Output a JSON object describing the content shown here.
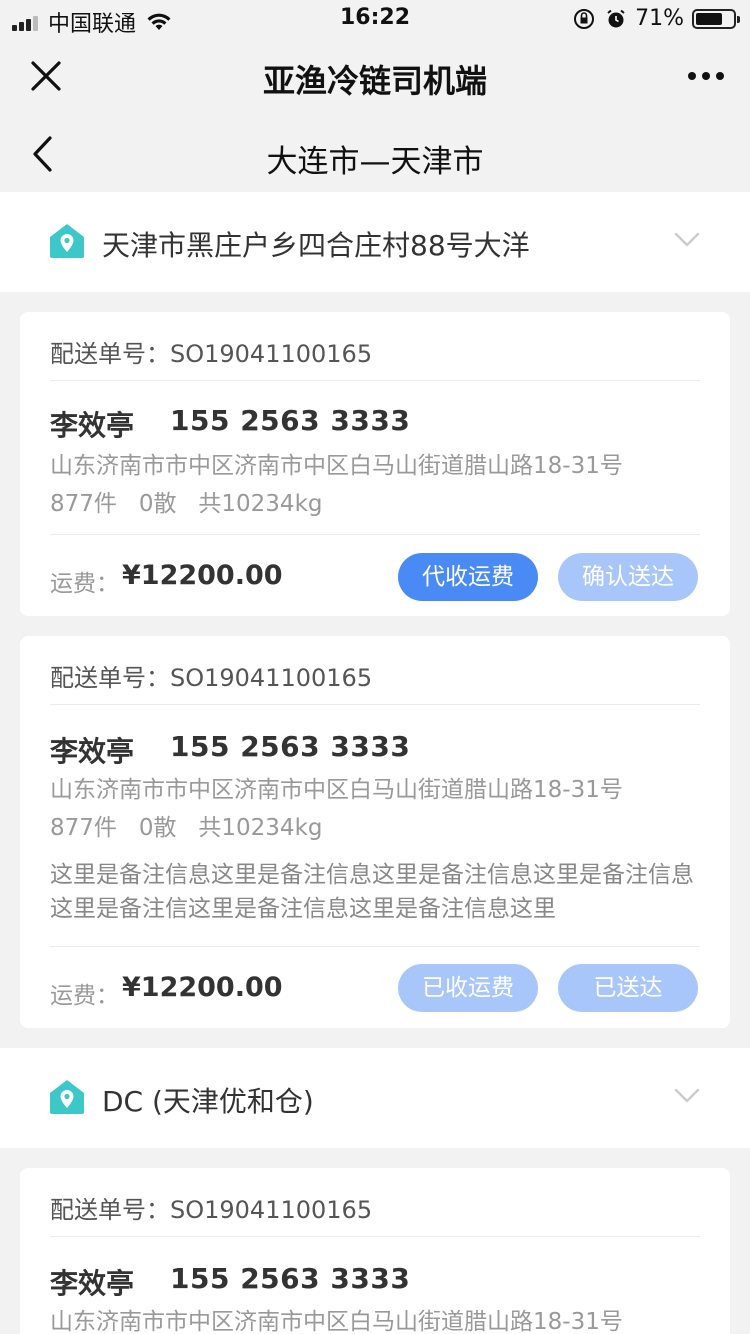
{
  "status_bar": {
    "carrier": "中国联通",
    "time": "16:22",
    "battery": "71%",
    "battery_level": 0.71
  },
  "header": {
    "title": "亚渔冷链司机端"
  },
  "route": {
    "title": "大连市—天津市"
  },
  "colors": {
    "accent": "#4a8af4",
    "accent_light": "#a9c6fa",
    "pin": "#3cc8c8"
  },
  "sections": [
    {
      "location": "天津市黑庄户乡四合庄村88号大洋",
      "orders": [
        {
          "order_label": "配送单号：",
          "order_no": "SO19041100165",
          "name": "李效亭",
          "phone": "155 2563 3333",
          "address": "山东济南市市中区济南市中区白马山街道腊山路18-31号",
          "quantity": "877件   0散   共10234kg",
          "fee_label": "运费：",
          "fee": "¥12200.00",
          "buttons": [
            "代收运费",
            "确认送达"
          ]
        },
        {
          "order_label": "配送单号：",
          "order_no": "SO19041100165",
          "name": "李效亭",
          "phone": "155 2563 3333",
          "address": "山东济南市市中区济南市中区白马山街道腊山路18-31号",
          "quantity": "877件   0散   共10234kg",
          "note": "这里是备注信息这里是备注信息这里是备注信息这里是备注信息这里是备注信这里是备注信息这里是备注信息这里",
          "fee_label": "运费：",
          "fee": "¥12200.00",
          "buttons": [
            "已收运费",
            "已送达"
          ]
        }
      ]
    },
    {
      "location": "DC (天津优和仓)",
      "orders": [
        {
          "order_label": "配送单号：",
          "order_no": "SO19041100165",
          "name": "李效亭",
          "phone": "155 2563 3333",
          "address": "山东济南市市中区济南市中区白马山街道腊山路18-31号"
        }
      ]
    }
  ]
}
